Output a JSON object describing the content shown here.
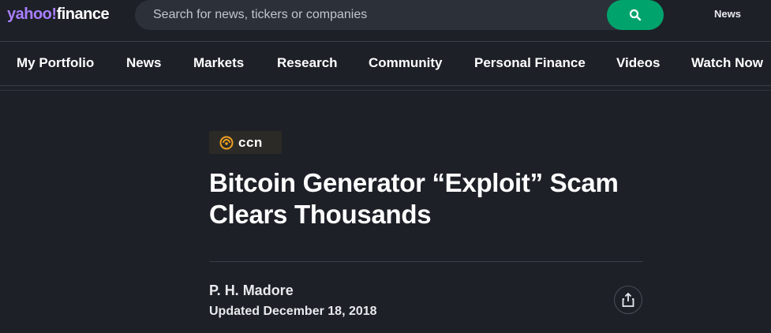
{
  "header": {
    "logo_yahoo": "yahoo",
    "logo_bang": "!",
    "logo_finance": "finance",
    "search_placeholder": "Search for news, tickers or companies",
    "search_icon": "search-icon",
    "top_link": "News"
  },
  "nav": {
    "items": [
      {
        "label": "My Portfolio"
      },
      {
        "label": "News"
      },
      {
        "label": "Markets"
      },
      {
        "label": "Research"
      },
      {
        "label": "Community"
      },
      {
        "label": "Personal Finance"
      },
      {
        "label": "Videos"
      },
      {
        "label": "Watch Now"
      }
    ]
  },
  "article": {
    "source": "ccn",
    "title": "Bitcoin Generator “Exploit” Scam Clears Thousands",
    "author": "P. H. Madore",
    "updated": "Updated December 18, 2018",
    "share_icon": "share-icon"
  },
  "colors": {
    "background": "#1d2027",
    "accent_green": "#00a36c",
    "brand_purple": "#a87fff",
    "ccn_orange": "#f0a020"
  }
}
